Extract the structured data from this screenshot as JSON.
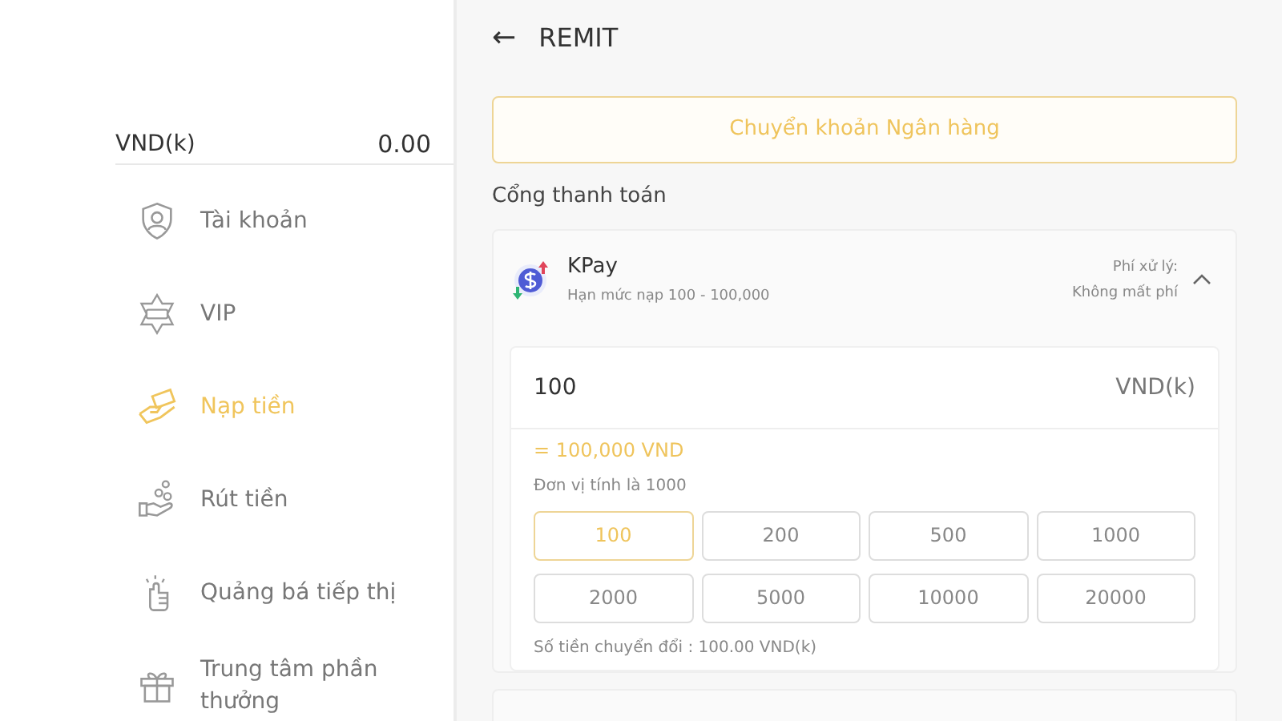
{
  "balance": {
    "currency": "VND(k)",
    "amount": "0.00"
  },
  "sidebar": {
    "items": [
      {
        "label": "Tài khoản",
        "selected": false
      },
      {
        "label": "VIP",
        "selected": false
      },
      {
        "label": "Nạp tiền",
        "selected": true
      },
      {
        "label": "Rút tiền",
        "selected": false
      },
      {
        "label": "Quảng bá tiếp thị",
        "selected": false
      },
      {
        "label": "Trung tâm phần thưởng",
        "selected": false
      }
    ]
  },
  "header": {
    "back": "←",
    "title": "REMIT"
  },
  "method_button": "Chuyển khoản Ngân hàng",
  "gateway_label": "Cổng thanh toán",
  "gateway": {
    "name": "KPay",
    "limit": "Hạn mức nạp 100 - 100,000",
    "fee_label": "Phí xử lý:",
    "fee_value": "Không mất phí",
    "expanded": true,
    "amount": {
      "value": "100",
      "unit": "VND(k)"
    },
    "equivalent": "= 100,000 VND",
    "unit_note": "Đơn vị tính là 1000",
    "presets": [
      {
        "label": "100",
        "selected": true
      },
      {
        "label": "200",
        "selected": false
      },
      {
        "label": "500",
        "selected": false
      },
      {
        "label": "1000",
        "selected": false
      },
      {
        "label": "2000",
        "selected": false
      },
      {
        "label": "5000",
        "selected": false
      },
      {
        "label": "10000",
        "selected": false
      },
      {
        "label": "20000",
        "selected": false
      }
    ],
    "converted": "Số tiền chuyển đổi : 100.00 VND(k)"
  }
}
